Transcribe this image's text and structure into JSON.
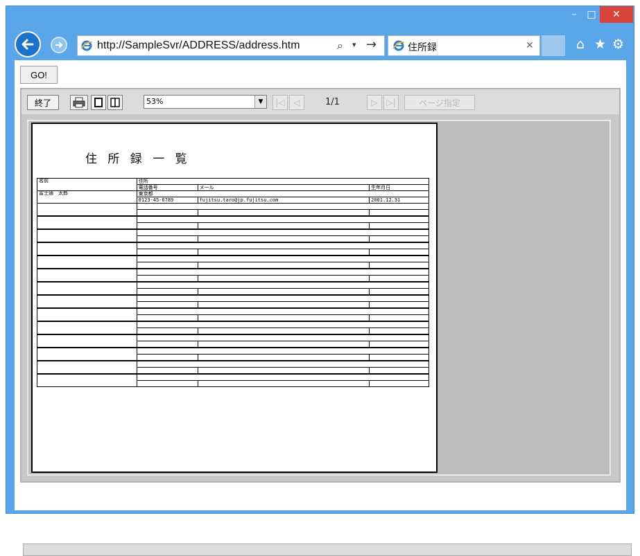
{
  "browser": {
    "url": "http://SampleSvr/ADDRESS/address.htm",
    "tab_title": "住所録",
    "window_controls": {
      "minimize_icon": "minimize-icon",
      "maximize_icon": "maximize-icon",
      "close_icon": "close-icon"
    },
    "tool_icons": [
      "home-icon",
      "star-icon",
      "gear-icon"
    ]
  },
  "page": {
    "go_button_label": "GO!"
  },
  "viewer_toolbar": {
    "exit_label": "終了",
    "zoom_value": "53%",
    "page_counter": "1/1",
    "page_jump_label": "ページ指定"
  },
  "report": {
    "title": "住 所 録 一 覧",
    "header": {
      "name": "名前",
      "address": "住所",
      "phone": "電話番号",
      "mail": "メール",
      "birthday": "生年月日"
    },
    "record": {
      "name": "富士通　太郎",
      "address": "東京都",
      "phone": "0123-45-6789",
      "mail": "fujitsu.taro@jp.fujitsu.com",
      "birthday": "2001.12.31"
    },
    "empty_rows": 14
  },
  "colors": {
    "frame": "#5aa6e8",
    "back_button": "#1e73c8",
    "close_button": "#d9443c",
    "viewer_bg": "#c8c8c8"
  }
}
